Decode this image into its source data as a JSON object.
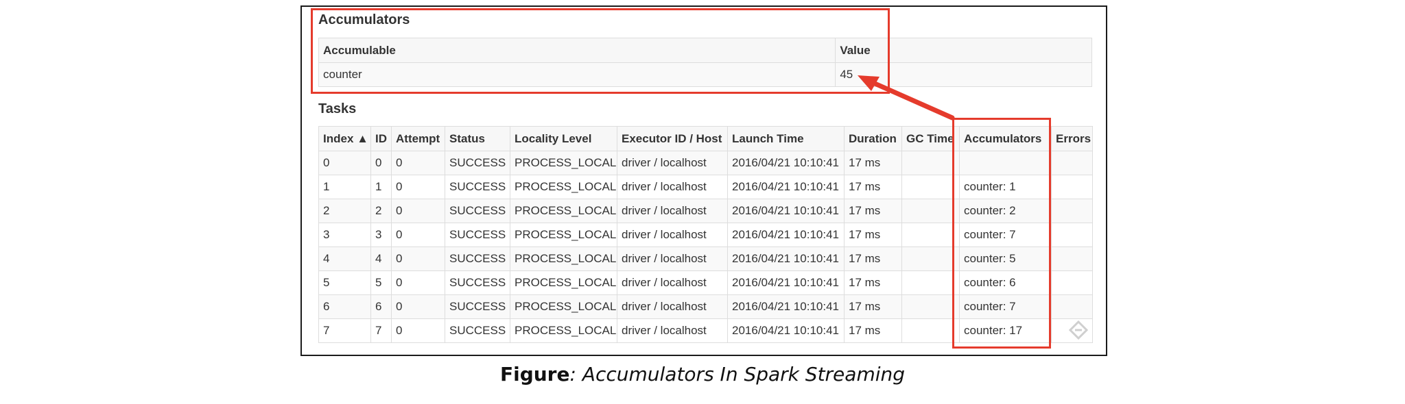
{
  "accumulators": {
    "title": "Accumulators",
    "headers": [
      "Accumulable",
      "Value"
    ],
    "rows": [
      [
        "counter",
        "45"
      ]
    ]
  },
  "tasks": {
    "title": "Tasks",
    "headers": [
      "Index ▲",
      "ID",
      "Attempt",
      "Status",
      "Locality Level",
      "Executor ID / Host",
      "Launch Time",
      "Duration",
      "GC Time",
      "Accumulators",
      "Errors"
    ],
    "rows": [
      [
        "0",
        "0",
        "0",
        "SUCCESS",
        "PROCESS_LOCAL",
        "driver / localhost",
        "2016/04/21 10:10:41",
        "17 ms",
        "",
        "",
        ""
      ],
      [
        "1",
        "1",
        "0",
        "SUCCESS",
        "PROCESS_LOCAL",
        "driver / localhost",
        "2016/04/21 10:10:41",
        "17 ms",
        "",
        "counter: 1",
        ""
      ],
      [
        "2",
        "2",
        "0",
        "SUCCESS",
        "PROCESS_LOCAL",
        "driver / localhost",
        "2016/04/21 10:10:41",
        "17 ms",
        "",
        "counter: 2",
        ""
      ],
      [
        "3",
        "3",
        "0",
        "SUCCESS",
        "PROCESS_LOCAL",
        "driver / localhost",
        "2016/04/21 10:10:41",
        "17 ms",
        "",
        "counter: 7",
        ""
      ],
      [
        "4",
        "4",
        "0",
        "SUCCESS",
        "PROCESS_LOCAL",
        "driver / localhost",
        "2016/04/21 10:10:41",
        "17 ms",
        "",
        "counter: 5",
        ""
      ],
      [
        "5",
        "5",
        "0",
        "SUCCESS",
        "PROCESS_LOCAL",
        "driver / localhost",
        "2016/04/21 10:10:41",
        "17 ms",
        "",
        "counter: 6",
        ""
      ],
      [
        "6",
        "6",
        "0",
        "SUCCESS",
        "PROCESS_LOCAL",
        "driver / localhost",
        "2016/04/21 10:10:41",
        "17 ms",
        "",
        "counter: 7",
        ""
      ],
      [
        "7",
        "7",
        "0",
        "SUCCESS",
        "PROCESS_LOCAL",
        "driver / localhost",
        "2016/04/21 10:10:41",
        "17 ms",
        "",
        "counter: 17",
        ""
      ]
    ]
  },
  "caption": {
    "bold": "Figure",
    "italic": ": Accumulators In Spark Streaming"
  },
  "colors": {
    "highlight": "#e53b2c",
    "frame": "#1a1a1a"
  },
  "icons": [
    "arrow-annotation-icon",
    "watermark-logo-icon"
  ]
}
